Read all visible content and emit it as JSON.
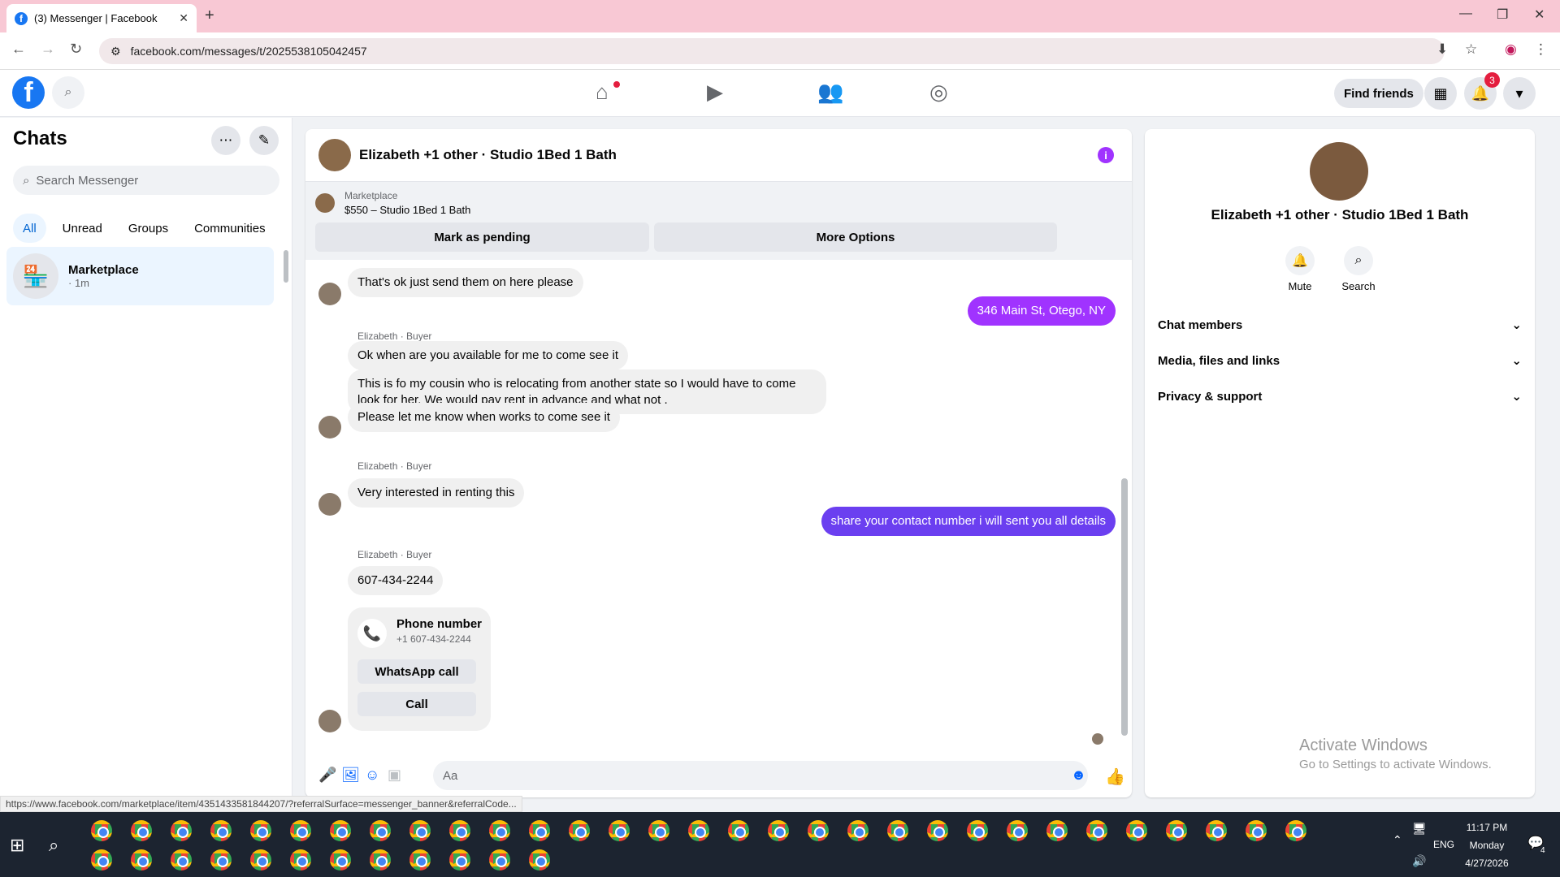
{
  "browser": {
    "tab_title": "(3) Messenger | Facebook",
    "tab_favicon": "f",
    "url": "facebook.com/messages/t/2025538105042457",
    "status_url": "https://www.facebook.com/marketplace/item/4351433581844207/?referralSurface=messenger_banner&referralCode..."
  },
  "fb": {
    "find_friends": "Find friends",
    "notif_count": "3",
    "logo": "f"
  },
  "chats": {
    "title": "Chats",
    "search_placeholder": "Search Messenger",
    "filters": [
      "All",
      "Unread",
      "Groups",
      "Communities"
    ],
    "items": [
      {
        "name": "Marketplace",
        "time": "· 1m"
      }
    ]
  },
  "conversation": {
    "title": "Elizabeth +1 other · Studio 1Bed 1 Bath",
    "banner_source": "Marketplace",
    "banner_listing": "$550 – Studio 1Bed 1 Bath",
    "mark_pending": "Mark as pending",
    "more_options": "More Options",
    "messages": {
      "m1": "That's ok just send them on here please",
      "m2": "346 Main St, Otego, NY",
      "sender1": "Elizabeth · Buyer",
      "m3": "Ok when are you available for me to come see it",
      "m4a": "This is fo my cousin who is relocating from another state so I would have to come",
      "m4b": "look for her. We would pay rent in advance and what not .",
      "m5": "Please let me know when works to come see it",
      "sender2": "Elizabeth · Buyer",
      "m6": "Very interested in renting this",
      "m7": "share your contact number i will sent you all details",
      "sender3": "Elizabeth · Buyer",
      "m8": "607-434-2244",
      "phone_title": "Phone number",
      "phone_value": "+1 607-434-2244",
      "whatsapp": "WhatsApp call",
      "call": "Call"
    },
    "composer_placeholder": "Aa"
  },
  "info": {
    "name": "Elizabeth +1 other · Studio 1Bed 1 Bath",
    "mute": "Mute",
    "search": "Search",
    "rows": [
      "Chat members",
      "Media, files and links",
      "Privacy & support"
    ]
  },
  "watermark": {
    "line1": "Activate Windows",
    "line2": "Go to Settings to activate Windows."
  },
  "taskbar": {
    "lang": "ENG",
    "time": "11:17 PM",
    "day": "Monday",
    "date": "4/27/2026",
    "notif": "4"
  },
  "colors": {
    "accent": "#a033ff",
    "fb_blue": "#1877f2",
    "outgoing_blue": "#6b3ff0"
  }
}
